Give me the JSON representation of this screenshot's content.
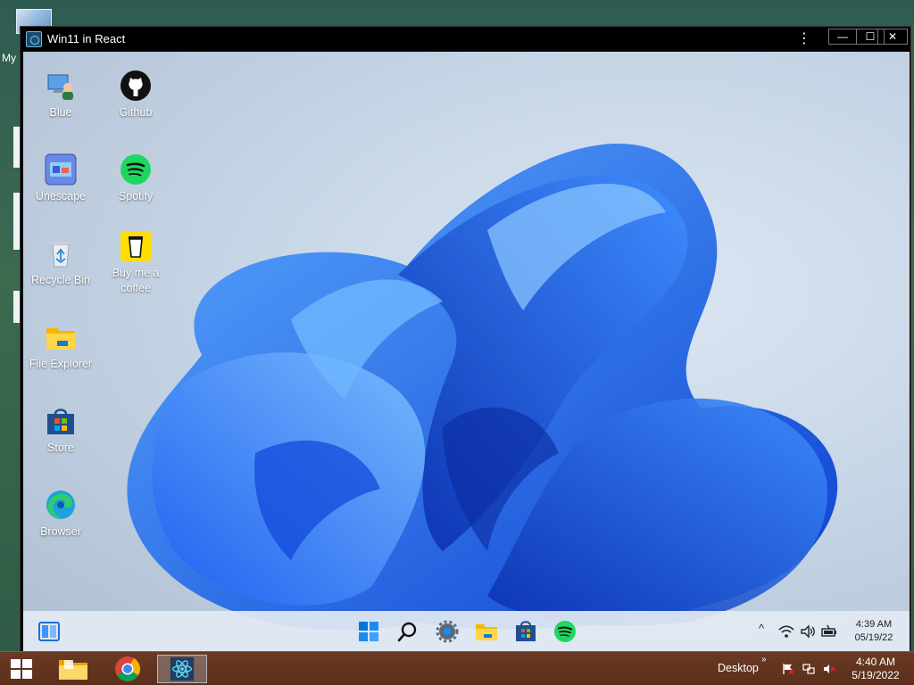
{
  "host": {
    "desktop_partial_label": "My",
    "taskbar": {
      "desktop_label": "Desktop",
      "chevron": "»",
      "time": "4:40 AM",
      "date": "5/19/2022",
      "apps": [
        "file-explorer-icon",
        "chrome-icon",
        "react-app-icon"
      ]
    }
  },
  "window": {
    "title": "Win11 in React",
    "menu_glyph": "⋮",
    "minimize_glyph": "—",
    "maximize_glyph": "☐",
    "close_glyph": "✕"
  },
  "desktop": {
    "icons": [
      {
        "label": "Blue",
        "icon": "user-computer-icon"
      },
      {
        "label": "Github",
        "icon": "github-icon"
      },
      {
        "label": "Unescape",
        "icon": "unescape-icon"
      },
      {
        "label": "Spotify",
        "icon": "spotify-icon"
      },
      {
        "label": "Recycle Bin",
        "icon": "recycle-bin-icon"
      },
      {
        "label": "Buy me a coffee",
        "icon": "coffee-icon"
      },
      {
        "label": "File Explorer",
        "icon": "folder-icon"
      },
      {
        "label": "Store",
        "icon": "store-icon"
      },
      {
        "label": "Browser",
        "icon": "edge-icon"
      }
    ]
  },
  "taskbar11": {
    "time": "4:39 AM",
    "date": "05/19/22",
    "apps": [
      "widgets-icon",
      "start-icon",
      "search-icon",
      "settings-icon",
      "file-explorer-icon",
      "store-icon",
      "spotify-icon"
    ],
    "tray": [
      "chevron-up-icon",
      "wifi-icon",
      "volume-icon",
      "battery-icon"
    ],
    "chevron_up_glyph": "^"
  },
  "colors": {
    "accent_blue": "#1a63e8",
    "spotify_green": "#1ed760",
    "host_taskbar": "#5e321e"
  }
}
